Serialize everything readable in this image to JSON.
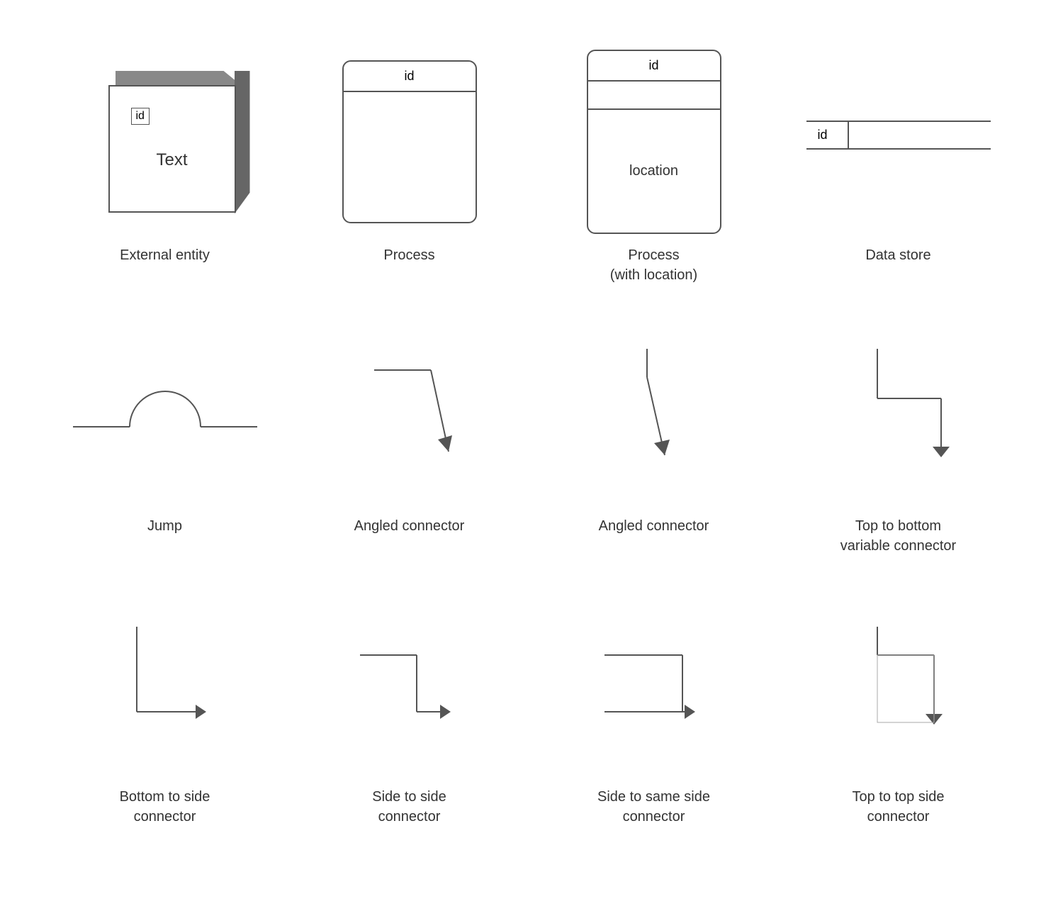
{
  "shapes": [
    {
      "id": "external-entity",
      "label": "External entity",
      "id_text": "id",
      "body_text": "Text"
    },
    {
      "id": "process",
      "label": "Process",
      "id_text": "id"
    },
    {
      "id": "process-location",
      "label": "Process\n(with location)",
      "id_text": "id",
      "location_text": "location"
    },
    {
      "id": "data-store",
      "label": "Data store",
      "id_text": "id"
    },
    {
      "id": "jump",
      "label": "Jump"
    },
    {
      "id": "angled-connector-1",
      "label": "Angled connector"
    },
    {
      "id": "angled-connector-2",
      "label": "Angled connector"
    },
    {
      "id": "ttb-variable-connector",
      "label": "Top to bottom\nvariable connector"
    },
    {
      "id": "bottom-to-side",
      "label": "Bottom to side\nconnector"
    },
    {
      "id": "side-to-side",
      "label": "Side to side\nconnector"
    },
    {
      "id": "side-to-same-side",
      "label": "Side to same side\nconnector"
    },
    {
      "id": "top-to-top-side",
      "label": "Top to top side\nconnector"
    }
  ]
}
